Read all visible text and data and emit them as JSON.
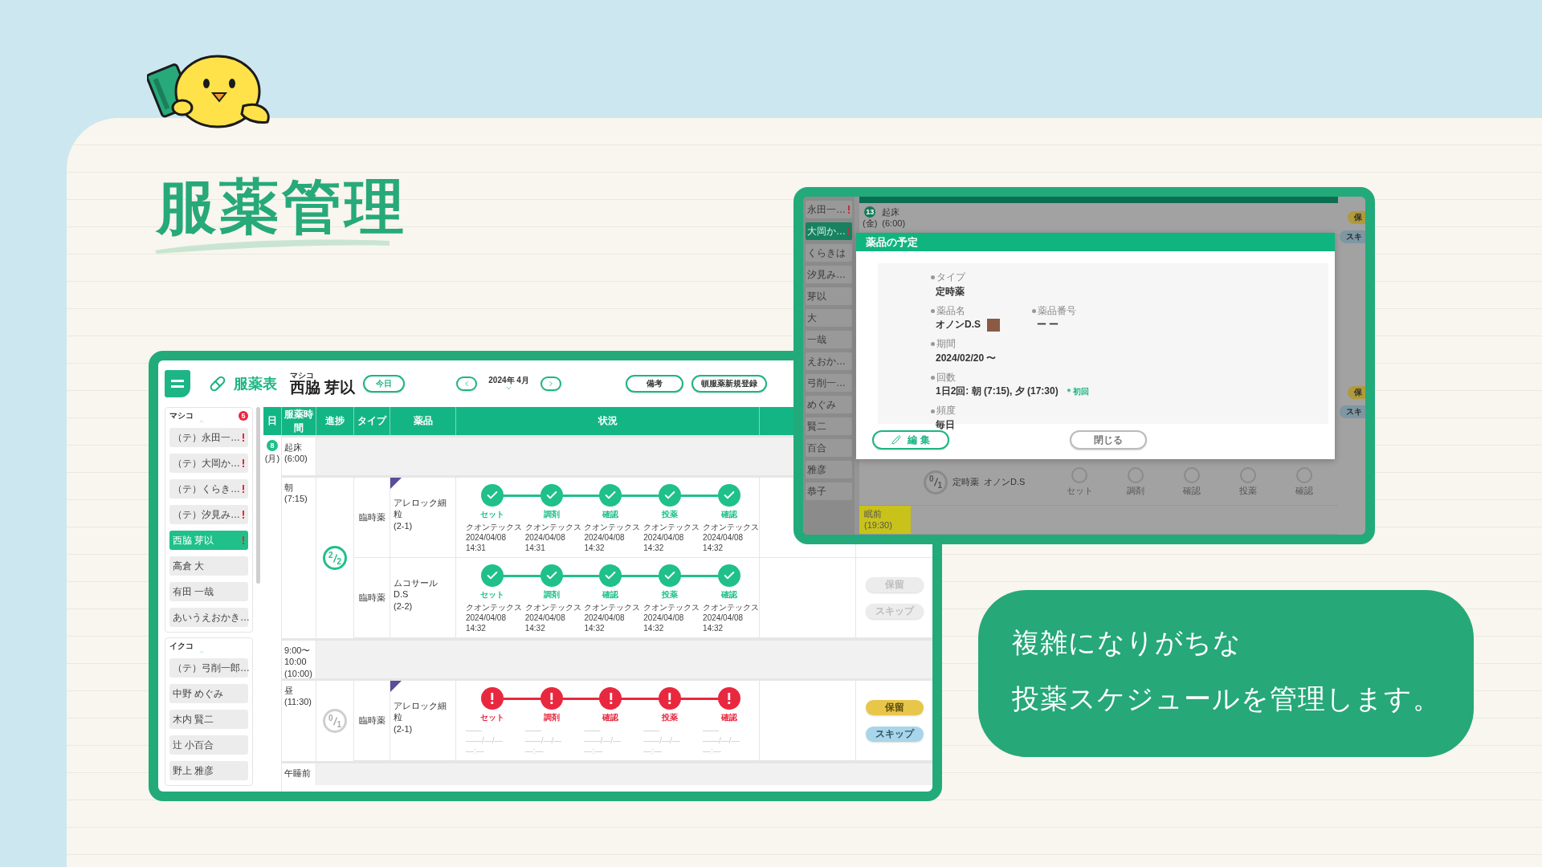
{
  "heading": {
    "title": "服薬管理"
  },
  "callout": {
    "lines": [
      "複雑になりがちな",
      "投薬スケジュールを管理します。"
    ]
  },
  "app": {
    "header": {
      "title": "服薬表",
      "group": "マシコ",
      "patient": "西脇 芽以",
      "today": "今日",
      "month": "2024年 4月",
      "buttons": [
        "備考",
        "頓服薬新規登録"
      ]
    },
    "sidebar": {
      "groups": [
        {
          "name": "マシコ",
          "badge": "5",
          "items": [
            {
              "label": "（テ）永田一…",
              "alert": true,
              "selected": false
            },
            {
              "label": "（テ）大岡か…",
              "alert": true,
              "selected": false
            },
            {
              "label": "（テ）くらき…",
              "alert": true,
              "selected": false
            },
            {
              "label": "（テ）汐見み…",
              "alert": true,
              "selected": false
            },
            {
              "label": "西脇 芽以",
              "alert": true,
              "selected": true
            },
            {
              "label": "高倉 大",
              "alert": false,
              "selected": false
            },
            {
              "label": "有田 一哉",
              "alert": false,
              "selected": false
            },
            {
              "label": "あいうえおかき…",
              "alert": false,
              "selected": false
            }
          ]
        },
        {
          "name": "イクコ",
          "items": [
            {
              "label": "（テ）弓削一郎…",
              "alert": false,
              "selected": false
            },
            {
              "label": "中野 めぐみ",
              "alert": false,
              "selected": false
            },
            {
              "label": "木内 賢二",
              "alert": false,
              "selected": false
            },
            {
              "label": "辻 小百合",
              "alert": false,
              "selected": false
            },
            {
              "label": "野上 雅彦",
              "alert": false,
              "selected": false
            }
          ]
        }
      ]
    },
    "columns": [
      "日",
      "服薬時間",
      "進捗",
      "タイプ",
      "薬品",
      "状況"
    ],
    "day": {
      "date": "8",
      "weekday": "(月)"
    },
    "slots": [
      {
        "kind": "section",
        "label": "起床",
        "time": "(6:00)"
      },
      {
        "kind": "dose",
        "label": "朝",
        "time": "(7:15)",
        "done": "2",
        "total": "2",
        "complete": true,
        "meds": [
          {
            "type": "臨時薬",
            "name": "アレロック細粒",
            "code": "(2-1)",
            "flagged": true,
            "steps": [
              {
                "label": "セット",
                "completed": true,
                "by": "クオンテックス",
                "date": "2024/04/08",
                "time": "14:31"
              },
              {
                "label": "調剤",
                "completed": true,
                "by": "クオンテックス",
                "date": "2024/04/08",
                "time": "14:31"
              },
              {
                "label": "確認",
                "completed": true,
                "by": "クオンテックス",
                "date": "2024/04/08",
                "time": "14:32"
              },
              {
                "label": "投薬",
                "completed": true,
                "by": "クオンテックス",
                "date": "2024/04/08",
                "time": "14:32"
              },
              {
                "label": "確認",
                "completed": true,
                "by": "クオンテックス",
                "date": "2024/04/08",
                "time": "14:32"
              }
            ]
          },
          {
            "type": "臨時薬",
            "name": "ムコサールD.S",
            "code": "(2-2)",
            "flagged": false,
            "steps": [
              {
                "label": "セット",
                "completed": true,
                "by": "クオンテックス",
                "date": "2024/04/08",
                "time": "14:32"
              },
              {
                "label": "調剤",
                "completed": true,
                "by": "クオンテックス",
                "date": "2024/04/08",
                "time": "14:32"
              },
              {
                "label": "確認",
                "completed": true,
                "by": "クオンテックス",
                "date": "2024/04/08",
                "time": "14:32"
              },
              {
                "label": "投薬",
                "completed": true,
                "by": "クオンテックス",
                "date": "2024/04/08",
                "time": "14:32"
              },
              {
                "label": "確認",
                "completed": true,
                "by": "クオンテックス",
                "date": "2024/04/08",
                "time": "14:32"
              }
            ],
            "actions": [
              {
                "label": "保留",
                "kind": "hold",
                "disabled": true
              },
              {
                "label": "スキップ",
                "kind": "skip",
                "disabled": true
              }
            ]
          }
        ]
      },
      {
        "kind": "section",
        "label": "9:00〜10:00",
        "time": "(10:00)"
      },
      {
        "kind": "dose",
        "label": "昼",
        "time": "(11:30)",
        "done": "0",
        "total": "1",
        "complete": false,
        "meds": [
          {
            "type": "臨時薬",
            "name": "アレロック細粒",
            "code": "(2-1)",
            "flagged": true,
            "steps": [
              {
                "label": "セット",
                "completed": false,
                "by": "——",
                "date": "——/—/—",
                "time": "—:—"
              },
              {
                "label": "調剤",
                "completed": false,
                "by": "——",
                "date": "——/—/—",
                "time": "—:—"
              },
              {
                "label": "確認",
                "completed": false,
                "by": "——",
                "date": "——/—/—",
                "time": "—:—"
              },
              {
                "label": "投薬",
                "completed": false,
                "by": "——",
                "date": "——/—/—",
                "time": "—:—"
              },
              {
                "label": "確認",
                "completed": false,
                "by": "——",
                "date": "——/—/—",
                "time": "—:—"
              }
            ],
            "actions": [
              {
                "label": "保留",
                "kind": "hold",
                "disabled": false
              },
              {
                "label": "スキップ",
                "kind": "skip",
                "disabled": false
              }
            ]
          }
        ]
      },
      {
        "kind": "section",
        "label": "午睡前"
      }
    ]
  },
  "modal_screen": {
    "background": {
      "sidebar": [
        {
          "label": "永田一…",
          "alert": true,
          "selected": false
        },
        {
          "label": "大岡か…",
          "alert": true,
          "selected": true
        },
        {
          "label": "くらきは",
          "alert": false,
          "selected": false
        },
        {
          "label": "汐見み…",
          "alert": false,
          "selected": false
        },
        {
          "label": "芽以",
          "alert": false,
          "selected": false
        },
        {
          "label": "大",
          "alert": false,
          "selected": false
        },
        {
          "label": "一哉",
          "alert": false,
          "selected": false
        },
        {
          "label": "えおか…",
          "alert": false,
          "selected": false
        },
        {
          "label": "弓削一…",
          "alert": false,
          "selected": false
        },
        {
          "label": "めぐみ",
          "alert": false,
          "selected": false
        },
        {
          "label": "賢二",
          "alert": false,
          "selected": false
        },
        {
          "label": "百合",
          "alert": false,
          "selected": false
        },
        {
          "label": "雅彦",
          "alert": false,
          "selected": false
        },
        {
          "label": "恭子",
          "alert": false,
          "selected": false
        }
      ],
      "day": {
        "date": "13",
        "weekday": "(金)"
      },
      "first_slot": {
        "label": "起床",
        "time": "(6:00)"
      },
      "dose": {
        "done": "0",
        "total": "1",
        "type": "定時薬",
        "name": "オノンD.S",
        "steps": [
          "セット",
          "調剤",
          "確認",
          "投薬",
          "確認"
        ]
      },
      "last_slot": {
        "label": "眠前",
        "time": "(19:30)"
      },
      "side_buttons": [
        {
          "label": "保",
          "kind": "hold"
        },
        {
          "label": "スキ",
          "kind": "skip"
        },
        {
          "label": "保",
          "kind": "hold"
        },
        {
          "label": "スキ",
          "kind": "skip"
        }
      ]
    },
    "dialog": {
      "title": "薬品の予定",
      "rows": [
        [
          {
            "label": "タイプ",
            "value": "定時薬"
          }
        ],
        [
          {
            "label": "薬品名",
            "value": "オノンD.S",
            "color": "#8b5a45"
          },
          {
            "label": "薬品番号",
            "value": "ー ー"
          }
        ],
        [
          {
            "label": "期間",
            "value": "2024/02/20 〜"
          }
        ],
        [
          {
            "label": "回数",
            "value": "1日2回: 朝 (7:15), 夕 (17:30)",
            "note": "＊初回"
          }
        ],
        [
          {
            "label": "頻度",
            "value": "毎日"
          }
        ]
      ],
      "edit": "編 集",
      "close": "閉じる"
    }
  }
}
